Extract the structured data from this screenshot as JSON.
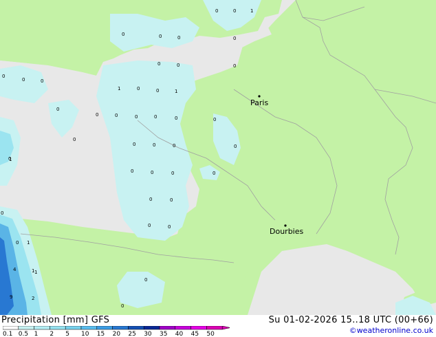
{
  "header": {
    "title": "Precipitation [mm]  GFS",
    "datetime": "Su 01-02-2026 15..18 UTC (00+66)",
    "credit": "©weatheronline.co.uk"
  },
  "cities": [
    {
      "name": "Paris"
    },
    {
      "name": "Dourbies"
    }
  ],
  "legend": {
    "labels": [
      "0.1",
      "0.5",
      "1",
      "2",
      "5",
      "10",
      "15",
      "20",
      "25",
      "30",
      "35",
      "40",
      "45",
      "50"
    ],
    "colors": [
      "#ffffff",
      "#c8f2f2",
      "#b4eef4",
      "#96e2f0",
      "#78d2ee",
      "#5abef0",
      "#3c9ee6",
      "#2878d2",
      "#1450b4",
      "#0a2896",
      "#a000c8",
      "#c800dc",
      "#e600e6",
      "#dc00b4"
    ]
  },
  "precip_values": [
    "0",
    "0",
    "1",
    "0",
    "0",
    "0",
    "0",
    "0",
    "0",
    "0",
    "0",
    "0",
    "1",
    "0",
    "0",
    "1",
    "0",
    "0",
    "0",
    "0",
    "0",
    "0",
    "0",
    "0",
    "0",
    "0",
    "0",
    "0",
    "0",
    "0",
    "0",
    "0",
    "0",
    "0",
    "0",
    "0",
    "0",
    "0",
    "0",
    "1",
    "0",
    "1",
    "1",
    "4",
    "1",
    "9",
    "2",
    "0",
    "0"
  ],
  "colors": {
    "land": "#c4f2a6",
    "sea": "#e8e8e8",
    "rain_light": "#c8f2f2",
    "rain_medium": "#9be4f0",
    "rain_heavy": "#5ab4e6",
    "border": "#a0a0a0"
  }
}
